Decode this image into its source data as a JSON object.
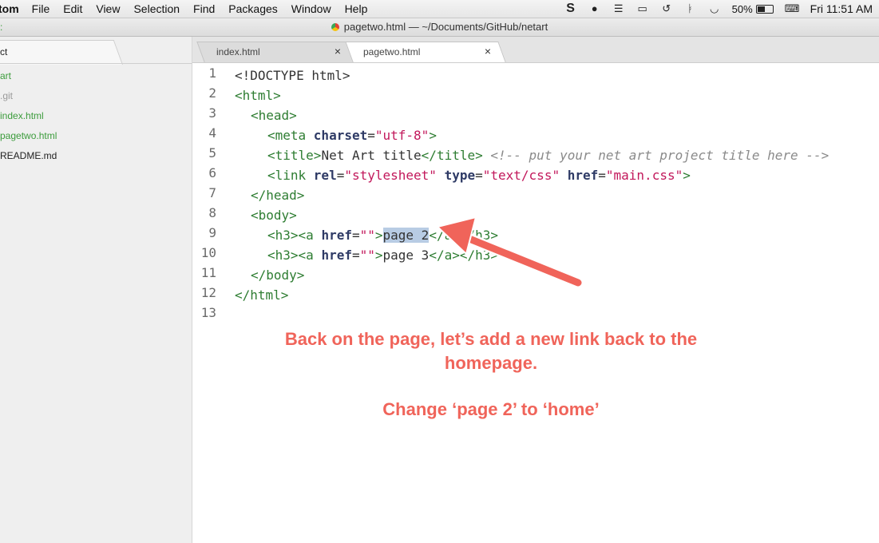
{
  "menubar": {
    "app": "tom",
    "items": [
      "File",
      "Edit",
      "View",
      "Selection",
      "Find",
      "Packages",
      "Window",
      "Help"
    ],
    "battery": "50%",
    "clock": "Fri 11:51 AM"
  },
  "window": {
    "title": "pagetwo.html — ~/Documents/GitHub/netart"
  },
  "tree": {
    "tab_label": "ct",
    "items": [
      {
        "label": "art",
        "color": "#3c9c3c"
      },
      {
        "label": ".git",
        "color": "#9a9a9a"
      },
      {
        "label": "index.html",
        "color": "#3c9c3c"
      },
      {
        "label": "pagetwo.html",
        "color": "#3c9c3c"
      },
      {
        "label": "README.md",
        "color": "#222222"
      }
    ]
  },
  "tabs": [
    {
      "label": "index.html",
      "close": "×"
    },
    {
      "label": "pagetwo.html",
      "close": "×"
    }
  ],
  "editor": {
    "line_numbers": [
      "1",
      "2",
      "3",
      "4",
      "5",
      "6",
      "7",
      "8",
      "9",
      "10",
      "11",
      "12",
      "13"
    ],
    "l1": "<!DOCTYPE html>",
    "l2": "<html>",
    "l3": "<head>",
    "l4_a": "<meta ",
    "l4_b": "charset",
    "l4_c": "=",
    "l4_d": "\"utf-8\"",
    "l4_e": ">",
    "l5_a": "<title>",
    "l5_b": "Net Art title",
    "l5_c": "</title>",
    "l5_d": "<!-- put your net art project title here -->",
    "l6_a": "<link ",
    "l6_b": "rel",
    "l6_c": "=",
    "l6_d": "\"stylesheet\"",
    "l6_e": " ",
    "l6_f": "type",
    "l6_g": "=",
    "l6_h": "\"text/css\"",
    "l6_i": " ",
    "l6_j": "href",
    "l6_k": "=",
    "l6_l": "\"main.css\"",
    "l6_m": ">",
    "l7": "</head>",
    "l8": "<body>",
    "l9_a": "<h3><a ",
    "l9_b": "href",
    "l9_c": "=",
    "l9_d": "\"\"",
    "l9_e": ">",
    "l9_f": "page 2",
    "l9_g": "</a></h3>",
    "l10_a": "<h3><a ",
    "l10_b": "href",
    "l10_c": "=",
    "l10_d": "\"\"",
    "l10_e": ">",
    "l10_f": "page 3",
    "l10_g": "</a></h3>",
    "l11": "</body>",
    "l12": "</html>"
  },
  "annotation": {
    "line1": "Back on the page, let’s add a new link back to the",
    "line2": "homepage.",
    "line3": "Change ‘page 2’ to ‘home’"
  },
  "colors": {
    "annotation": "#f0645a",
    "selection": "#b8cce4"
  }
}
